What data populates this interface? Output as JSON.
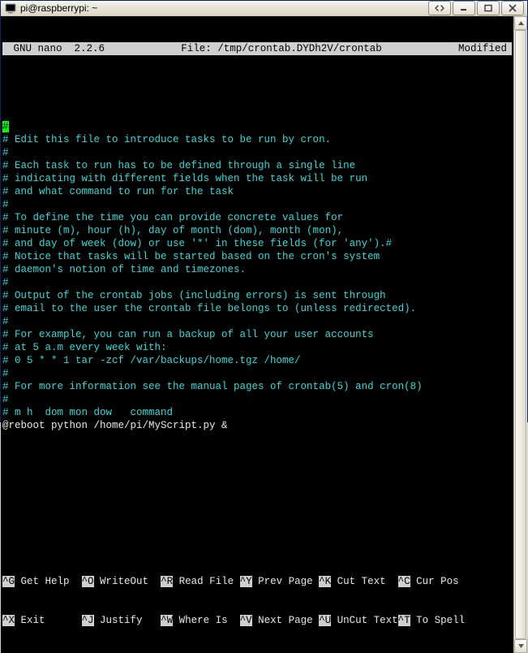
{
  "window": {
    "title": "pi@raspberrypi: ~"
  },
  "nano": {
    "app": "GNU nano",
    "version": "2.2.6",
    "file_label": "File:",
    "file_path": "/tmp/crontab.DYDh2V/crontab",
    "status": "Modified"
  },
  "lines": [
    "#",
    "# Edit this file to introduce tasks to be run by cron.",
    "#",
    "# Each task to run has to be defined through a single line",
    "# indicating with different fields when the task will be run",
    "# and what command to run for the task",
    "#",
    "# To define the time you can provide concrete values for",
    "# minute (m), hour (h), day of month (dom), month (mon),",
    "# and day of week (dow) or use '*' in these fields (for 'any').#",
    "# Notice that tasks will be started based on the cron's system",
    "# daemon's notion of time and timezones.",
    "#",
    "# Output of the crontab jobs (including errors) is sent through",
    "# email to the user the crontab file belongs to (unless redirected).",
    "#",
    "# For example, you can run a backup of all your user accounts",
    "# at 5 a.m every week with:",
    "# 0 5 * * 1 tar -zcf /var/backups/home.tgz /home/",
    "#",
    "# For more information see the manual pages of crontab(5) and cron(8)",
    "#",
    "# m h  dom mon dow   command",
    "@reboot python /home/pi/MyScript.py &"
  ],
  "shortcuts": {
    "row1": [
      {
        "key": "^G",
        "label": "Get Help"
      },
      {
        "key": "^O",
        "label": "WriteOut"
      },
      {
        "key": "^R",
        "label": "Read File"
      },
      {
        "key": "^Y",
        "label": "Prev Page"
      },
      {
        "key": "^K",
        "label": "Cut Text"
      },
      {
        "key": "^C",
        "label": "Cur Pos"
      }
    ],
    "row2": [
      {
        "key": "^X",
        "label": "Exit"
      },
      {
        "key": "^J",
        "label": "Justify"
      },
      {
        "key": "^W",
        "label": "Where Is"
      },
      {
        "key": "^V",
        "label": "Next Page"
      },
      {
        "key": "^U",
        "label": "UnCut Text"
      },
      {
        "key": "^T",
        "label": "To Spell"
      }
    ]
  }
}
